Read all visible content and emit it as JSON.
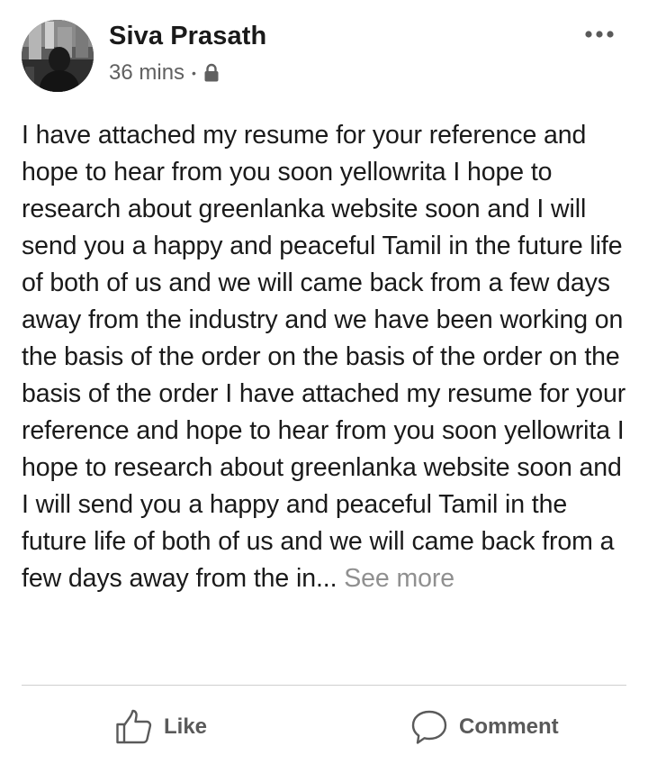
{
  "post": {
    "author": "Siva Prasath",
    "timestamp": "36 mins",
    "separator": "•",
    "privacy_icon": "lock-icon",
    "menu_icon": "more-horizontal-icon",
    "body_text": "I have attached my resume for your reference and hope to hear from you soon yellowrita I hope to research about greenlanka website soon and I will send you a happy and peaceful Tamil in the future life of both of us and we will came back from a few days away from the industry and we have been working on the basis of the order on the basis of the order on the basis of the order I have attached my resume for your reference and hope to hear from you soon yellowrita I hope to research about greenlanka website soon and I will send you a happy and peaceful Tamil in the future life of both of us and we will came back from a few days away from the in...",
    "see_more": "See more"
  },
  "actions": {
    "like_label": "Like",
    "like_icon": "thumbs-up-icon",
    "comment_label": "Comment",
    "comment_icon": "speech-bubble-icon"
  },
  "colors": {
    "text": "#1a1a1a",
    "secondary_text": "#606060",
    "see_more": "#909090",
    "divider": "#cfcfcf",
    "action_text": "#5a5a5a"
  }
}
